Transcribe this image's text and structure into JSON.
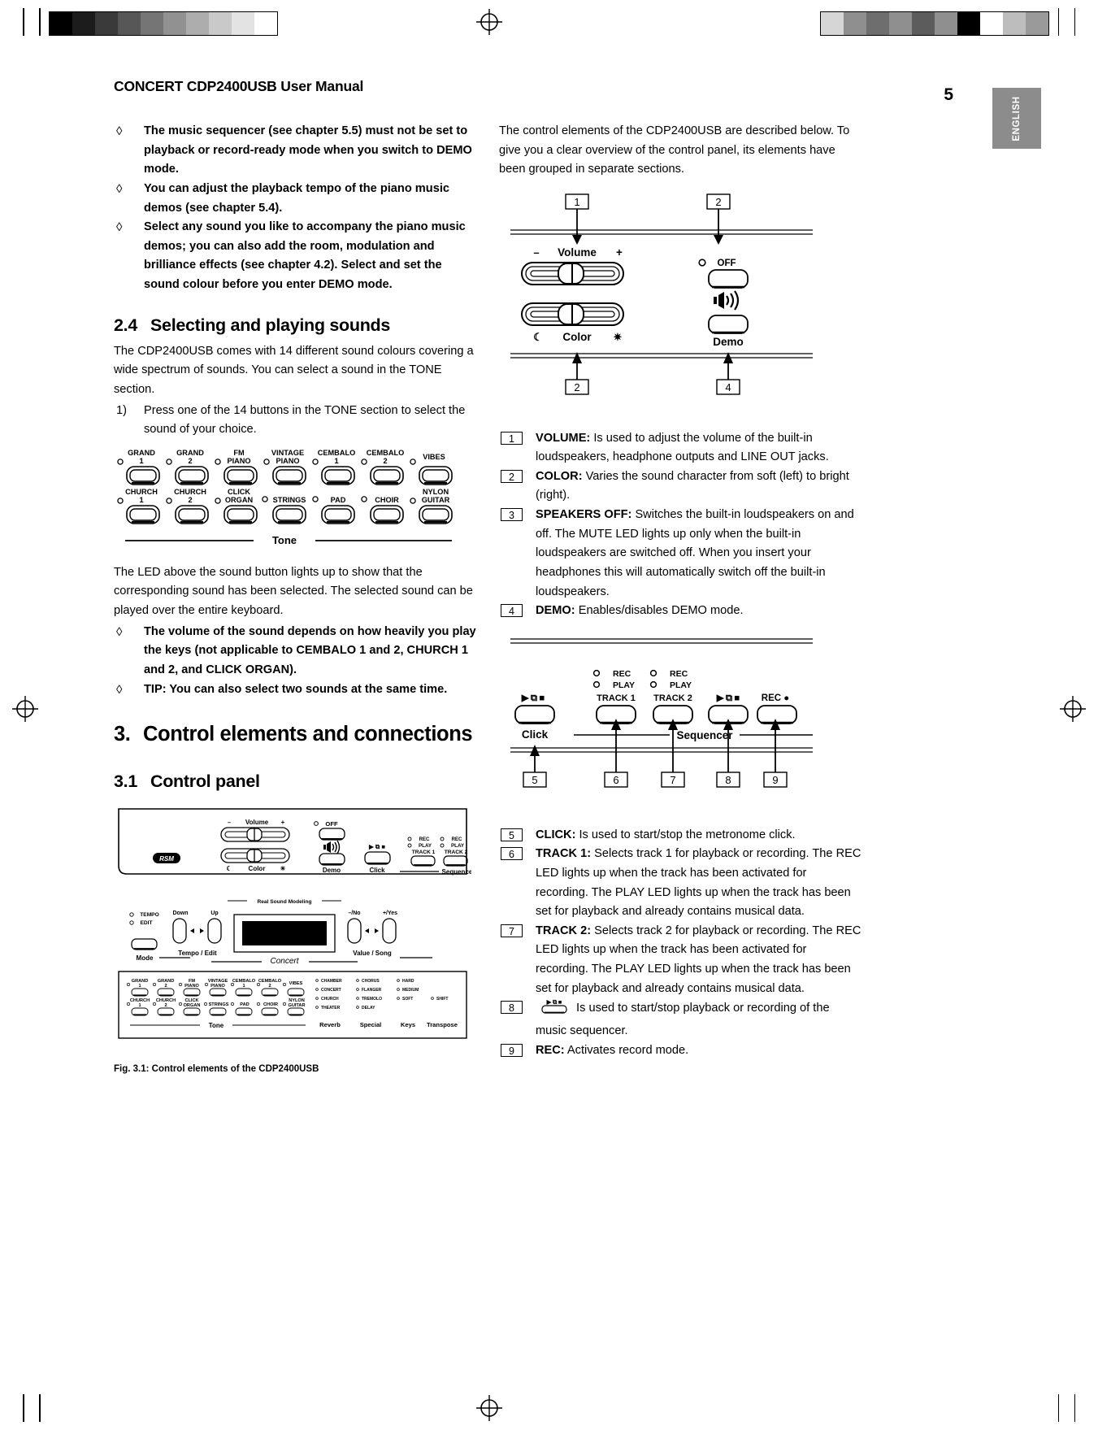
{
  "header": {
    "doc_title": "CONCERT CDP2400USB User Manual",
    "page_number": "5",
    "language_tab": "ENGLISH"
  },
  "left_column": {
    "bullets_top": [
      "The music sequencer (see chapter 5.5) must not be set to playback or record-ready mode when you switch to DEMO mode.",
      "You can adjust the playback tempo of the piano music demos (see chapter 5.4).",
      "Select any sound you like to accompany the piano music demos; you can also add the room, modulation and brilliance effects (see chapter 4.2). Select and set the sound colour before you enter DEMO mode."
    ],
    "section_2_4": {
      "number": "2.4",
      "title": "Selecting and playing sounds",
      "intro": "The CDP2400USB comes with 14 different sound colours covering a wide spectrum of sounds. You can select a sound in the TONE section.",
      "step_number": "1)",
      "step_text": "Press one of the 14 buttons in the TONE section to select the sound of your choice."
    },
    "tone_diagram": {
      "label": "Tone",
      "row1": [
        "GRAND\n1",
        "GRAND\n2",
        "FM\nPIANO",
        "VINTAGE\nPIANO",
        "CEMBALO\n1",
        "CEMBALO\n2",
        "VIBES"
      ],
      "row2": [
        "CHURCH\n1",
        "CHURCH\n2",
        "CLICK\nORGAN",
        "STRINGS",
        "PAD",
        "CHOIR",
        "NYLON\nGUITAR"
      ]
    },
    "after_tone_paragraph": "The LED above the sound button lights up to show that the corresponding sound has been selected. The selected sound can be played over the entire keyboard.",
    "bullets_bottom": [
      "The volume of the sound depends on how heavily you play the keys (not applicable to CEMBALO 1 and 2, CHURCH 1 and 2, and CLICK ORGAN).",
      "TIP: You can also select two sounds at the same time."
    ],
    "chapter_3": {
      "number": "3.",
      "title": "Control elements and connections"
    },
    "section_3_1": {
      "number": "3.1",
      "title": "Control panel"
    },
    "figure": {
      "caption": "Fig. 3.1: Control elements of the CDP2400USB",
      "brand_badge": "RSM",
      "labels": {
        "volume": "Volume",
        "volume_minus": "–",
        "volume_plus": "+",
        "color": "Color",
        "color_soft": "☾",
        "color_bright": "☀",
        "off": "OFF",
        "demo": "Demo",
        "click": "Click",
        "sequencer": "Sequencer",
        "track1": "TRACK 1",
        "track2": "TRACK 2",
        "rec": "REC",
        "play": "PLAY",
        "transport": "▶ / ■",
        "tempo": "TEMPO",
        "edit": "EDIT",
        "down": "Down",
        "up": "Up",
        "tempo_edit": "Tempo / Edit",
        "mode": "Mode",
        "real_sound_modeling": "Real Sound Modeling",
        "concert": "Concert",
        "minus_no": "–/No",
        "plus_yes": "+/Yes",
        "value_song": "Value / Song",
        "tone": "Tone",
        "reverb": "Reverb",
        "special": "Special",
        "keys": "Keys",
        "transpose": "Transpose",
        "effects_col1": [
          "CHAMBER",
          "CONCERT",
          "CHURCH",
          "THEATER"
        ],
        "effects_col2": [
          "CHORUS",
          "FLANGER",
          "TREMOLO",
          "DELAY"
        ],
        "effects_col3": [
          "HARD",
          "MEDIUM",
          "SOFT",
          "SHIFT"
        ],
        "tone_row1": [
          "GRAND\n1",
          "GRAND\n2",
          "FM\nPIANO",
          "VINTAGE\nPIANO",
          "CEMBALO\n1",
          "CEMBALO\n2",
          "VIBES"
        ],
        "tone_row2": [
          "CHURCH\n1",
          "CHURCH\n2",
          "CLICK\nORGAN",
          "STRINGS",
          "PAD",
          "CHOIR",
          "NYLON\nGUITAR"
        ]
      }
    }
  },
  "right_column": {
    "intro": "The control elements of the CDP2400USB are described below. To give you a clear overview of the control panel, its elements have been grouped in separate sections.",
    "diagram_1": {
      "callout_top_left": "1",
      "callout_top_right": "2",
      "callout_bottom_left": "2",
      "callout_bottom_right": "4",
      "volume_label": "Volume",
      "volume_minus": "–",
      "volume_plus": "+",
      "color_label": "Color",
      "color_soft": "☾",
      "color_bright": "☀",
      "off_label": "OFF",
      "demo_label": "Demo"
    },
    "legend_1": [
      {
        "num": "1",
        "term": "VOLUME:",
        "text": " Is used to adjust the volume of the built-in loudspeakers, headphone outputs and LINE OUT jacks."
      },
      {
        "num": "2",
        "term": "COLOR:",
        "text": " Varies the sound character from soft (left) to bright (right)."
      },
      {
        "num": "3",
        "term": "SPEAKERS OFF:",
        "text": " Switches the built-in loudspeakers on and off. The MUTE LED lights up only when the built-in loudspeakers are switched off. When you insert your headphones this will automatically switch off the built-in loudspeakers."
      },
      {
        "num": "4",
        "term": "DEMO:",
        "text": " Enables/disables DEMO mode."
      }
    ],
    "diagram_2": {
      "click_label": "Click",
      "sequencer_label": "Sequencer",
      "track1_label": "TRACK 1",
      "track2_label": "TRACK 2",
      "rec_label": "REC",
      "play_label": "PLAY",
      "transport_label": "▶ / ■",
      "rec_button_label": "REC",
      "callouts": [
        "5",
        "6",
        "7",
        "8",
        "9"
      ]
    },
    "legend_2": [
      {
        "num": "5",
        "term": "CLICK:",
        "text": " Is used to start/stop the metronome click."
      },
      {
        "num": "6",
        "term": "TRACK 1:",
        "text": " Selects track 1 for playback or recording. The REC LED lights up when the track has been activated for recording. The PLAY LED lights up when the track has been set for playback and already contains musical data."
      },
      {
        "num": "7",
        "term": "TRACK 2:",
        "text": " Selects track 2 for playback or recording. The REC LED lights up when the track has been activated for recording. The PLAY LED lights up when the track has been set for playback and already contains musical data."
      },
      {
        "num": "8",
        "term": "",
        "text": " Is used to start/stop playback or recording of the music sequencer."
      },
      {
        "num": "9",
        "term": "REC:",
        "text": " Activates record mode."
      }
    ]
  }
}
